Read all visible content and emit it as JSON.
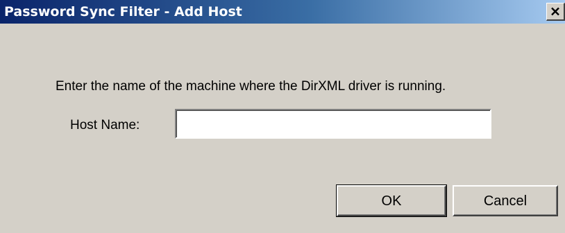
{
  "window": {
    "title": "Password Sync Filter - Add Host",
    "close_icon": "close-icon"
  },
  "dialog": {
    "prompt": "Enter the name of the machine where the DirXML driver is running.",
    "host_label": "Host Name:",
    "host_value": "",
    "host_placeholder": ""
  },
  "buttons": {
    "ok_label": "OK",
    "cancel_label": "Cancel"
  },
  "colors": {
    "titlebar_start": "#0a246a",
    "titlebar_end": "#a6caf0",
    "dialog_background": "#d4d0c8"
  }
}
